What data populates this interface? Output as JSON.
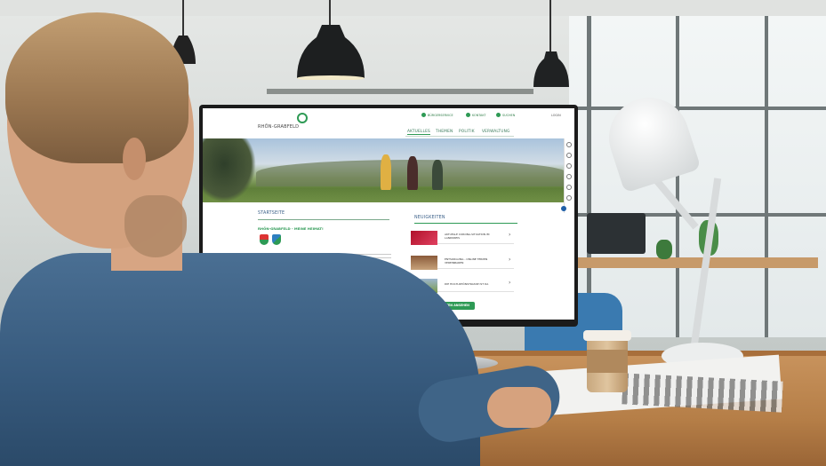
{
  "website": {
    "logo_name": "RHÖN-GRABFELD",
    "util_items": [
      "BÜRGERSERVICE",
      "KONTAKT",
      "SUCHEN"
    ],
    "util_right": [
      "LOGIN"
    ],
    "nav": [
      "AKTUELLES",
      "THEMEN",
      "POLITIK",
      "VERWALTUNG"
    ],
    "left_heading": "STARTSEITE",
    "left_subheading": "RHÖN-GRABFELD - MEINE HEIMAT!",
    "news_heading": "NEUIGKEITEN",
    "news_items": [
      "AKTUELLE CORONA-SITUATION IM LANDKREIS",
      "ENTSORGUNG - ONLINE TERMIN VEREINBAREN",
      "DIE HOCH-RHÖNSTRASSE IST DA"
    ],
    "all_news_button": "ALLE NEUIGKEITEN ANSEHEN"
  },
  "colors": {
    "brand_green": "#2e9a55",
    "heading_blue": "#3a5f88"
  }
}
